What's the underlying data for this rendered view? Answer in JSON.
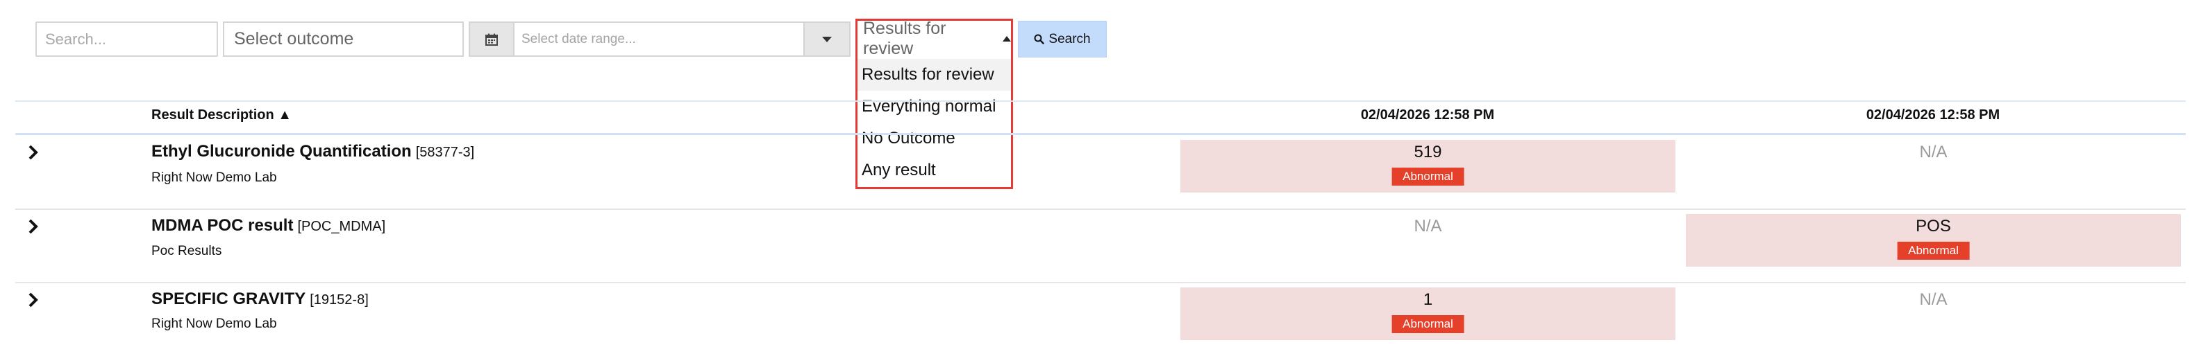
{
  "filters": {
    "search_placeholder": "Search...",
    "outcome_placeholder": "Select outcome",
    "date_placeholder": "Select date range...",
    "calendar_icon": "calendar-icon",
    "review_dropdown": {
      "selected": "Results for review",
      "options": [
        "Results for review",
        "Everything normal",
        "No Outcome",
        "Any result"
      ]
    },
    "search_button_label": "Search",
    "search_button_icon": "search-icon"
  },
  "table": {
    "header": {
      "description": "Result Description ▲",
      "columns": [
        "02/04/2026 12:58 PM",
        "02/04/2026 12:58 PM"
      ]
    },
    "rows": [
      {
        "name": "Ethyl Glucuronide Quantification",
        "code": "[58377-3]",
        "lab": "Right Now Demo Lab",
        "results": [
          {
            "value": "519",
            "flag": "Abnormal"
          },
          {
            "value": "N/A",
            "flag": ""
          }
        ]
      },
      {
        "name": "MDMA POC result",
        "code": "[POC_MDMA]",
        "lab": "Poc Results",
        "results": [
          {
            "value": "N/A",
            "flag": ""
          },
          {
            "value": "POS",
            "flag": "Abnormal"
          }
        ]
      },
      {
        "name": "SPECIFIC GRAVITY",
        "code": "[19152-8]",
        "lab": "Right Now Demo Lab",
        "results": [
          {
            "value": "1",
            "flag": "Abnormal"
          },
          {
            "value": "N/A",
            "flag": ""
          }
        ]
      }
    ]
  },
  "colors": {
    "abnormal_badge": "#e5402a",
    "abnormal_cell": "#f3dcdc",
    "search_button": "#c4dcfb",
    "dropdown_highlight_border": "#e53935"
  }
}
